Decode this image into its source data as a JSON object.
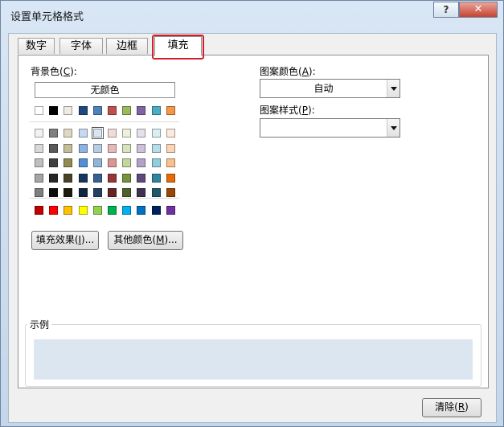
{
  "window": {
    "title": "设置单元格格式",
    "help_label": "?",
    "close_label": "✕"
  },
  "tabs": [
    {
      "label": "数字",
      "active": false
    },
    {
      "label": "字体",
      "active": false
    },
    {
      "label": "边框",
      "active": false
    },
    {
      "label": "填充",
      "active": true
    }
  ],
  "fill": {
    "background_label": "背景色(",
    "background_key": "C",
    "background_suffix": "):",
    "no_color_label": "无颜色",
    "theme_top_row": [
      "#ffffff",
      "#000000",
      "#eeece1",
      "#1f497d",
      "#4f81bd",
      "#c0504d",
      "#9bbb59",
      "#8064a2",
      "#4bacc6",
      "#f79646"
    ],
    "theme_shades": [
      [
        "#f2f2f2",
        "#7f7f7f",
        "#ddd9c3",
        "#c6d9f0",
        "#dbe5f1",
        "#f2dcdb",
        "#ebf1dd",
        "#e5e0ec",
        "#dbeef3",
        "#fdeada"
      ],
      [
        "#d8d8d8",
        "#595959",
        "#c4bd97",
        "#8db3e2",
        "#b8cce4",
        "#e5b9b7",
        "#d7e3bc",
        "#ccc1d9",
        "#b7dde8",
        "#fbd5b5"
      ],
      [
        "#bfbfbf",
        "#3f3f3f",
        "#938953",
        "#548dd4",
        "#95b3d7",
        "#d99694",
        "#c3d69b",
        "#b2a2c7",
        "#92cddc",
        "#fac08f"
      ],
      [
        "#a5a5a5",
        "#262626",
        "#494429",
        "#17365d",
        "#366092",
        "#953734",
        "#76923c",
        "#5f497a",
        "#31859b",
        "#e36c09"
      ],
      [
        "#7f7f7f",
        "#0c0c0c",
        "#1d1b10",
        "#0f243e",
        "#244061",
        "#632423",
        "#4f6128",
        "#3f3151",
        "#205867",
        "#974806"
      ]
    ],
    "selected_color": "#dbe5f1",
    "standard_colors": [
      "#c00000",
      "#ff0000",
      "#ffc000",
      "#ffff00",
      "#92d050",
      "#00b050",
      "#00b0f0",
      "#0070c0",
      "#002060",
      "#7030a0"
    ],
    "fill_effects_label": "填充效果(",
    "fill_effects_key": "I",
    "fill_effects_suffix": ")...",
    "more_colors_label": "其他颜色(",
    "more_colors_key": "M",
    "more_colors_suffix": ")...",
    "pattern_color_label": "图案颜色(",
    "pattern_color_key": "A",
    "pattern_color_suffix": "):",
    "pattern_color_value": "自动",
    "pattern_style_label": "图案样式(",
    "pattern_style_key": "P",
    "pattern_style_suffix": "):",
    "pattern_style_value": "",
    "sample_label": "示例",
    "sample_color": "#dce6f1"
  },
  "footer": {
    "clear_label": "清除(",
    "clear_key": "R",
    "clear_suffix": ")"
  }
}
